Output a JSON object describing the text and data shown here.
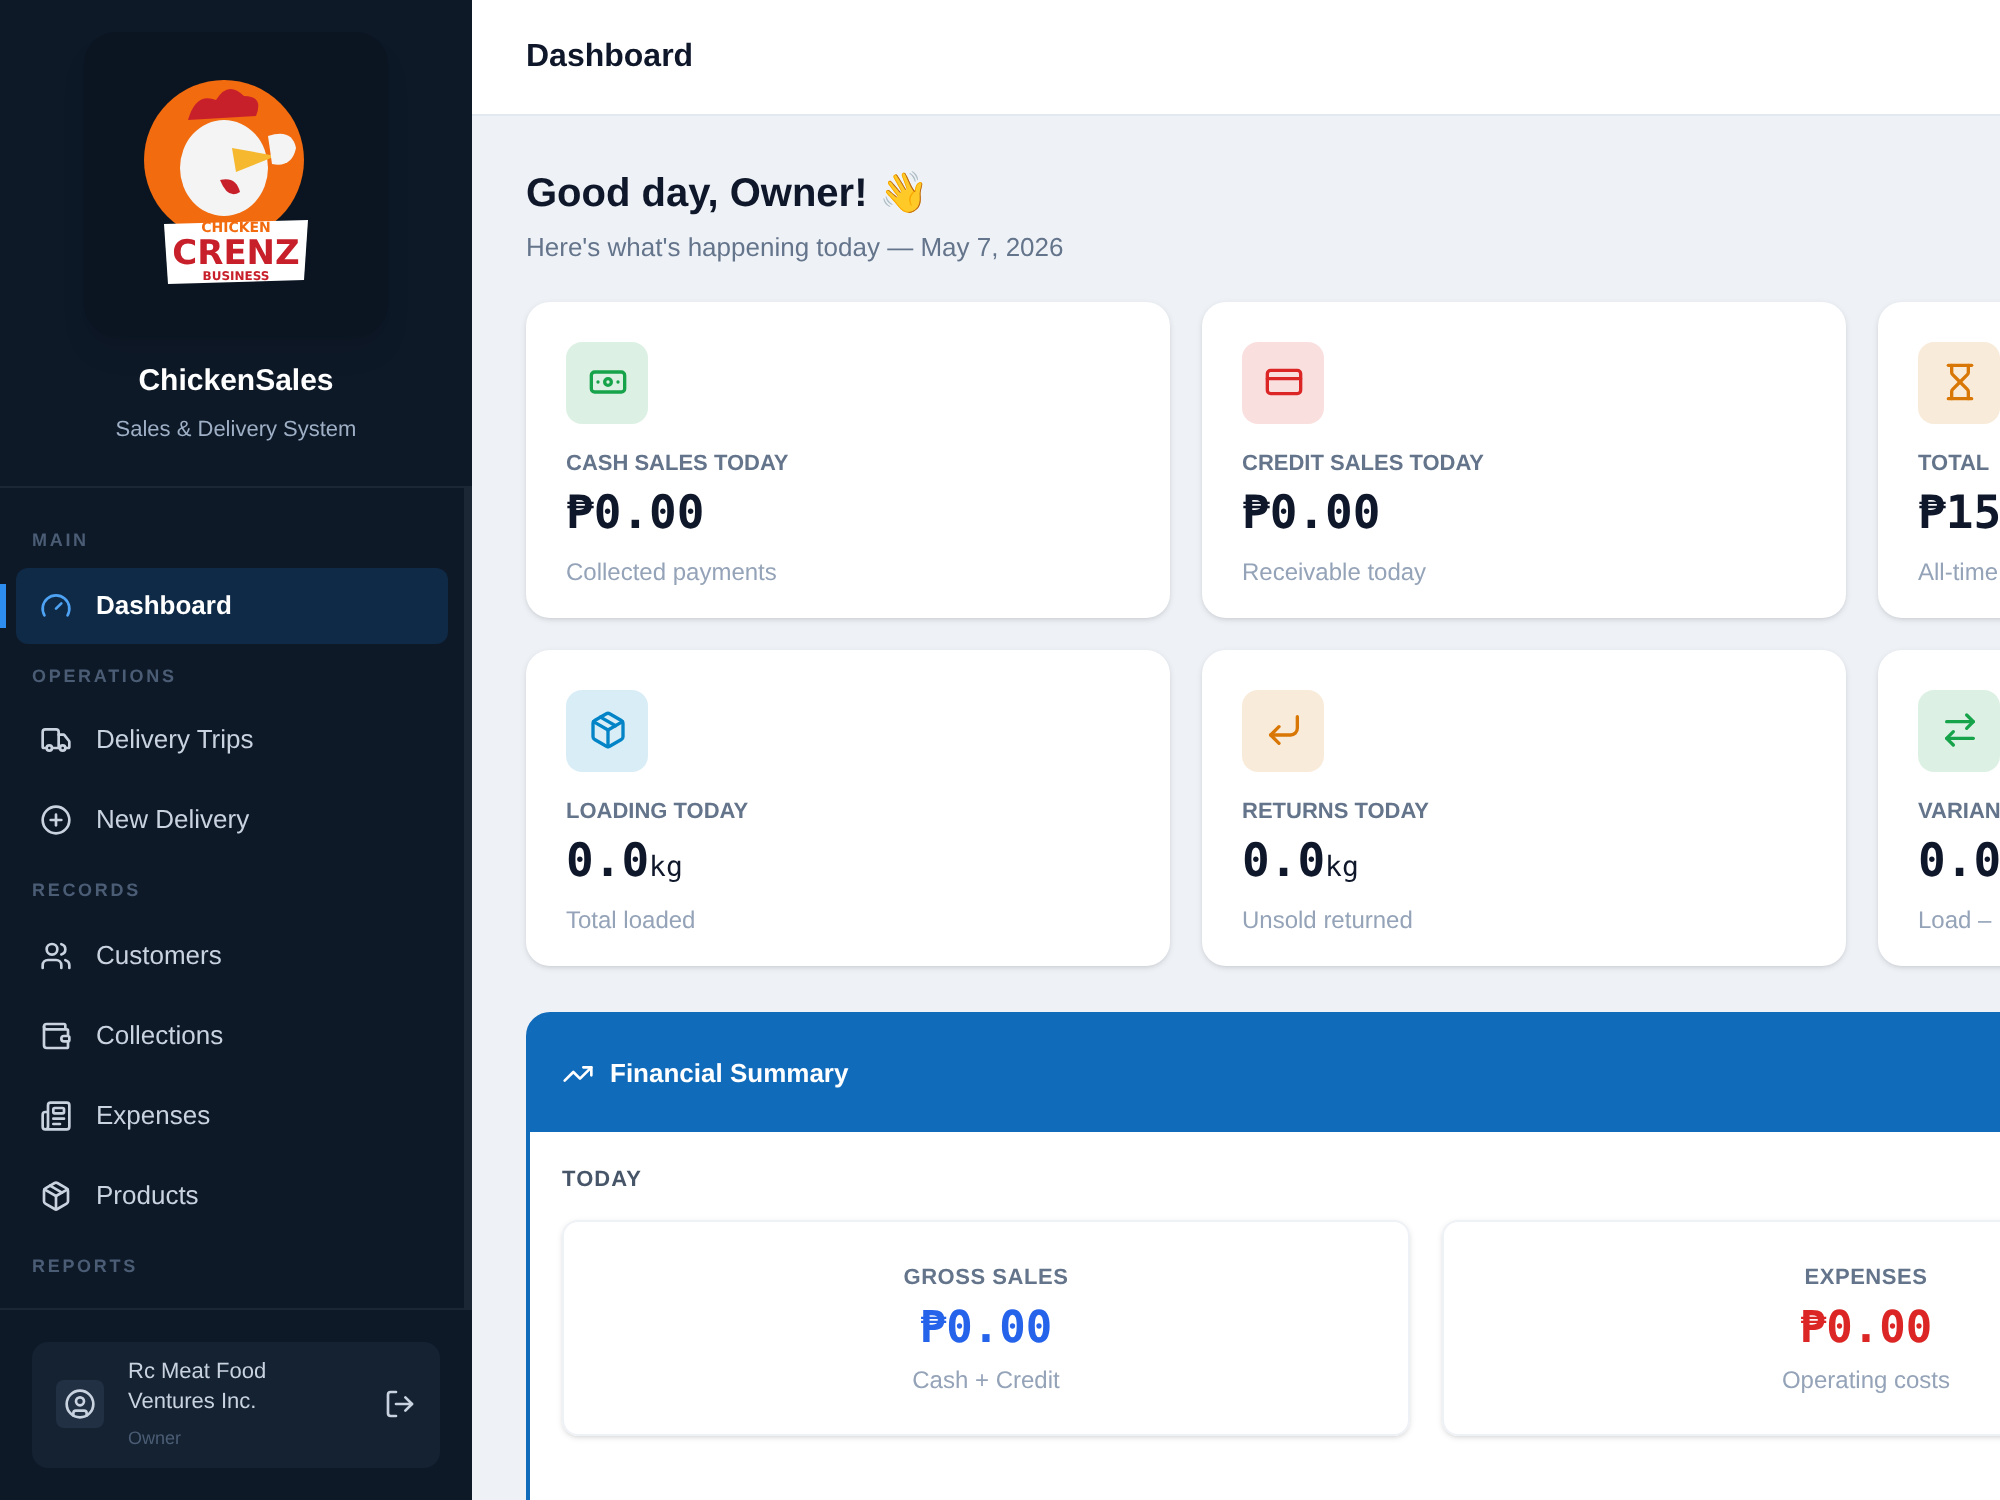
{
  "sidebar": {
    "logo": {
      "line1": "CHICKEN",
      "line2": "CRENZ",
      "line3": "BUSINESS"
    },
    "app_name": "ChickenSales",
    "app_subtitle": "Sales & Delivery System",
    "sections": [
      {
        "title": "MAIN",
        "items": [
          {
            "label": "Dashboard",
            "selected": true
          }
        ]
      },
      {
        "title": "OPERATIONS",
        "items": [
          {
            "label": "Delivery Trips",
            "selected": false
          },
          {
            "label": "New Delivery",
            "selected": false
          }
        ]
      },
      {
        "title": "RECORDS",
        "items": [
          {
            "label": "Customers",
            "selected": false
          },
          {
            "label": "Collections",
            "selected": false
          },
          {
            "label": "Expenses",
            "selected": false
          },
          {
            "label": "Products",
            "selected": false
          }
        ]
      },
      {
        "title": "REPORTS"
      }
    ],
    "user": {
      "name": "Rc Meat Food Ventures Inc.",
      "role": "Owner"
    }
  },
  "header": {
    "title": "Dashboard"
  },
  "greeting": {
    "title": "Good day, Owner! 👋",
    "subtitle": "Here's what's happening today — May 7, 2026"
  },
  "stat_cards": [
    {
      "color": "#16a34a",
      "label": "CASH SALES TODAY",
      "value": "₱0.00",
      "note": "Collected payments"
    },
    {
      "color": "#dc2626",
      "label": "CREDIT SALES TODAY",
      "value": "₱0.00",
      "note": "Receivable today"
    },
    {
      "color": "#d97706",
      "label": "TOTAL",
      "value": "₱15",
      "note": "All-time"
    },
    {
      "color": "#0284c7",
      "label": "LOADING TODAY",
      "value": "0.0",
      "unit": "kg",
      "note": "Total loaded"
    },
    {
      "color": "#d97706",
      "label": "RETURNS TODAY",
      "value": "0.0",
      "unit": "kg",
      "note": "Unsold returned"
    },
    {
      "color": "#16a34a",
      "label": "VARIAN",
      "value": "0.0",
      "note": "Load –"
    }
  ],
  "financial_summary": {
    "title": "Financial Summary",
    "period": "TODAY",
    "items": [
      {
        "label": "GROSS SALES",
        "value": "₱0.00",
        "note": "Cash + Credit",
        "color": "#2563eb"
      },
      {
        "label": "EXPENSES",
        "value": "₱0.00",
        "note": "Operating costs",
        "color": "#dc2626"
      }
    ]
  }
}
